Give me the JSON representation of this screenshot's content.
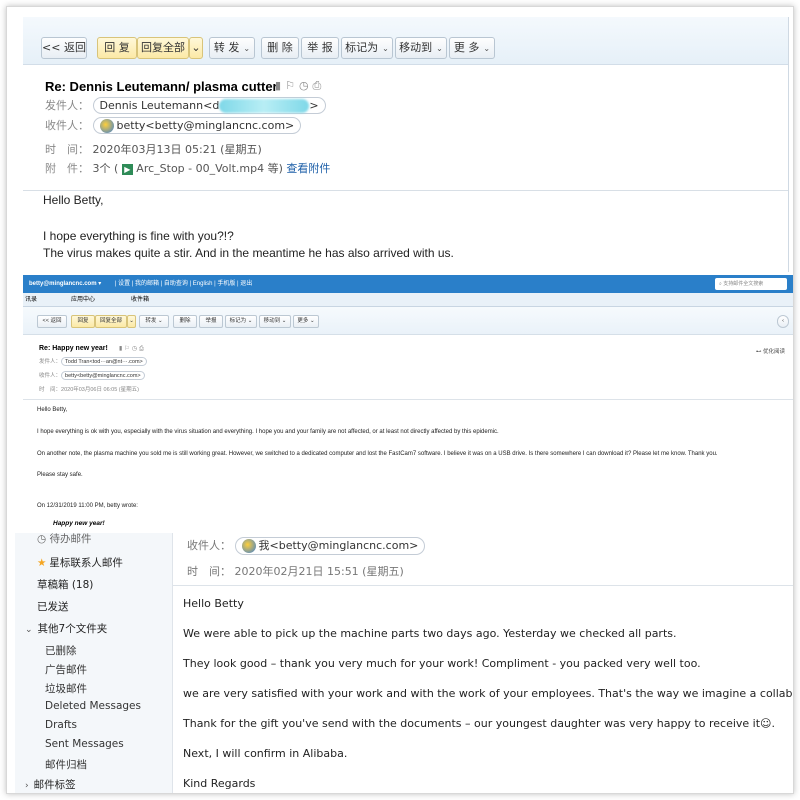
{
  "panel1": {
    "toolbar": {
      "back": "<< 返回",
      "reply": "回 复",
      "reply_all": "回复全部",
      "forward": "转 发",
      "delete": "删 除",
      "report": "举 报",
      "mark_as": "标记为",
      "move_to": "移动到",
      "more": "更 多"
    },
    "subject": "Re: Dennis Leutemann/ plasma cutter",
    "from_label": "发件人：",
    "from_value": "Dennis Leutemann<d",
    "to_label": "收件人：",
    "to_value": "betty<betty@minglancnc.com>",
    "time_label": "时　间：",
    "time_value": "2020年03月13日 05:21 (星期五)",
    "attach_label": "附　件：",
    "attach_count": "3个 (",
    "attach_file": "Arc_Stop - 00_Volt.mp4 等)",
    "attach_link": "查看附件",
    "body": [
      "Hello Betty,",
      "I hope everything is fine with you?!?",
      "The virus makes quite a stir. And in the meantime he has also arrived with us."
    ]
  },
  "panel2": {
    "topbar": {
      "account": "betty@minglancnc.com ▾",
      "nav": "|  设置  |  我的邮箱  |  自助查询  |  English  |  手机版  |  退出",
      "search": "支持邮件全文搜索"
    },
    "tabs": [
      "讯录",
      "应用中心",
      "收件箱"
    ],
    "toolbar": {
      "back": "<< 返回",
      "reply": "回复",
      "reply_all": "回复全部",
      "forward": "转发",
      "delete": "删除",
      "report": "举报",
      "mark_as": "标记为",
      "move_to": "移动到",
      "more": "更多"
    },
    "subject": "Re: Happy new year!",
    "from_label": "发件人：",
    "from_value": "Todd Tran<tod···an@nt···.com>",
    "to_label": "收件人：",
    "to_value": "betty<betty@minglancnc.com>",
    "time_label": "时　间：",
    "time_value": "2020年03月06日 06:05 (星期五)",
    "side_action": "优化阅读",
    "body": [
      "Hello Betty,",
      "I hope everything is ok with you, especially with the virus situation and everything.  I hope you and your family are not affected, or at least not directly affected by this epidemic.",
      "On another note, the plasma machine you sold me is still working great.  However, we switched to a dedicated computer and lost the FastCam7 software.  I believe it was on a USB drive.  Is there somewhere I can download it?  Please let me know.  Thank you.",
      "Please stay safe.",
      "On 12/31/2019 11:00 PM, betty wrote:"
    ],
    "quote": "Happy new year!"
  },
  "panel3": {
    "sidebar": {
      "partial_top": "待办邮件",
      "starred": "星标联系人邮件",
      "drafts": "草稿箱 (18)",
      "sent": "已发送",
      "other_folders": "其他7个文件夹",
      "subfolders": [
        "已删除",
        "广告邮件",
        "垃圾邮件",
        "Deleted Messages",
        "Drafts",
        "Sent Messages",
        "邮件归档"
      ],
      "tags": "邮件标签"
    },
    "to_label": "收件人：",
    "to_value": "我<betty@minglancnc.com>",
    "time_label": "时　间：",
    "time_value": "2020年02月21日 15:51 (星期五)",
    "body": [
      "Hello Betty",
      "We were able to pick up the machine parts two days ago. Yesterday we checked all parts.",
      "They look good – thank you very much for your work! Compliment - you packed very well too.",
      "we are very satisfied with your work and with the work of your employees. That's the way we imagine a collaboration.",
      "Thank for the gift you've send with the documents – our youngest daughter was very happy to receive it☺.",
      "Next, I will confirm in Alibaba.",
      "Kind Regards"
    ]
  }
}
